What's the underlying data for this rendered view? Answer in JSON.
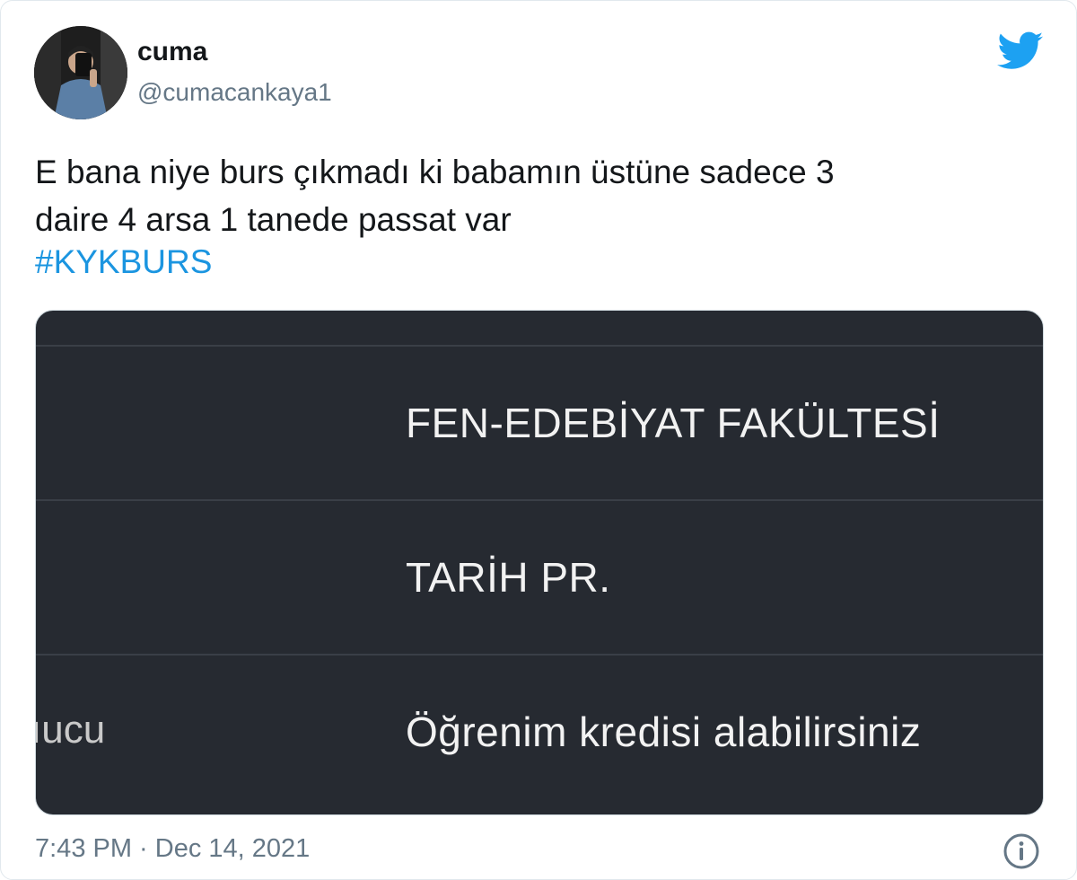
{
  "user": {
    "display_name": "cuma",
    "handle": "@cumacankaya1",
    "avatar_icon": "profile-photo",
    "verified": false
  },
  "brand": {
    "icon": "twitter-bird-icon",
    "color": "#1da1f2"
  },
  "tweet": {
    "text": "E bana niye burs çıkmadı ki babamın üstüne sadece 3\ndaire 4 arsa 1 tanede passat var",
    "hashtag": "#KYKBURS",
    "hashtag_color": "#1b95e0"
  },
  "media": {
    "background": "#262a31",
    "rows": [
      {
        "text": "FEN-EDEBİYAT FAKÜLTESİ"
      },
      {
        "text": "TARİH PR."
      },
      {
        "text": "Öğrenim kredisi alabilirsiniz",
        "left_fragment": "ıucu"
      }
    ]
  },
  "footer": {
    "timestamp": "7:43 PM · Dec 14, 2021",
    "info_icon": "info-icon"
  }
}
